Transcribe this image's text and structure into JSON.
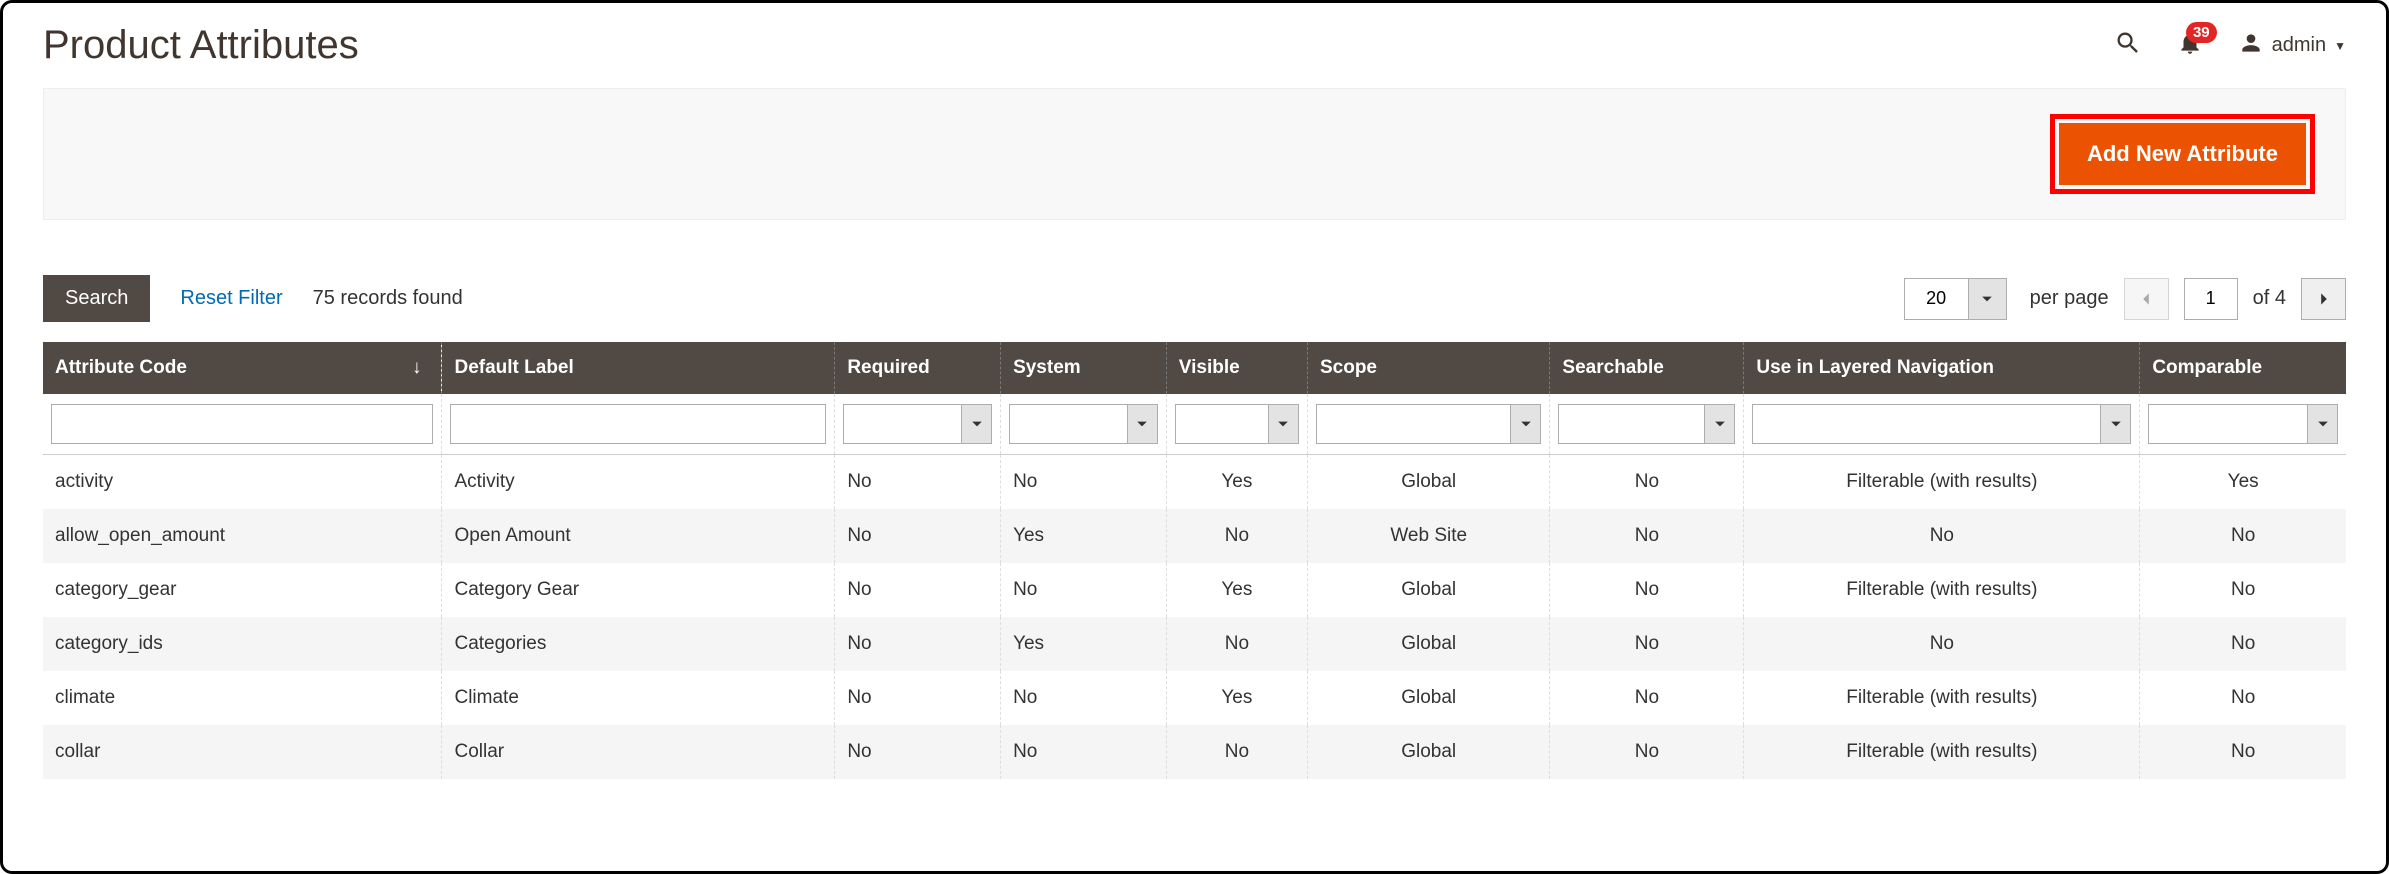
{
  "header": {
    "title": "Product Attributes",
    "notification_count": "39",
    "user_label": "admin"
  },
  "actions": {
    "add_label": "Add New Attribute"
  },
  "filters": {
    "search_label": "Search",
    "reset_label": "Reset Filter",
    "records_found": "75 records found",
    "per_page_value": "20",
    "per_page_label": "per page",
    "page_value": "1",
    "of_label": "of 4"
  },
  "columns": {
    "attribute_code": "Attribute Code",
    "default_label": "Default Label",
    "required": "Required",
    "system": "System",
    "visible": "Visible",
    "scope": "Scope",
    "searchable": "Searchable",
    "layered_nav": "Use in Layered Navigation",
    "comparable": "Comparable"
  },
  "rows": [
    {
      "code": "activity",
      "label": "Activity",
      "required": "No",
      "system": "No",
      "visible": "Yes",
      "scope": "Global",
      "searchable": "No",
      "layered": "Filterable (with results)",
      "comparable": "Yes"
    },
    {
      "code": "allow_open_amount",
      "label": "Open Amount",
      "required": "No",
      "system": "Yes",
      "visible": "No",
      "scope": "Web Site",
      "searchable": "No",
      "layered": "No",
      "comparable": "No"
    },
    {
      "code": "category_gear",
      "label": "Category Gear",
      "required": "No",
      "system": "No",
      "visible": "Yes",
      "scope": "Global",
      "searchable": "No",
      "layered": "Filterable (with results)",
      "comparable": "No"
    },
    {
      "code": "category_ids",
      "label": "Categories",
      "required": "No",
      "system": "Yes",
      "visible": "No",
      "scope": "Global",
      "searchable": "No",
      "layered": "No",
      "comparable": "No"
    },
    {
      "code": "climate",
      "label": "Climate",
      "required": "No",
      "system": "No",
      "visible": "Yes",
      "scope": "Global",
      "searchable": "No",
      "layered": "Filterable (with results)",
      "comparable": "No"
    },
    {
      "code": "collar",
      "label": "Collar",
      "required": "No",
      "system": "No",
      "visible": "No",
      "scope": "Global",
      "searchable": "No",
      "layered": "Filterable (with results)",
      "comparable": "No"
    }
  ]
}
